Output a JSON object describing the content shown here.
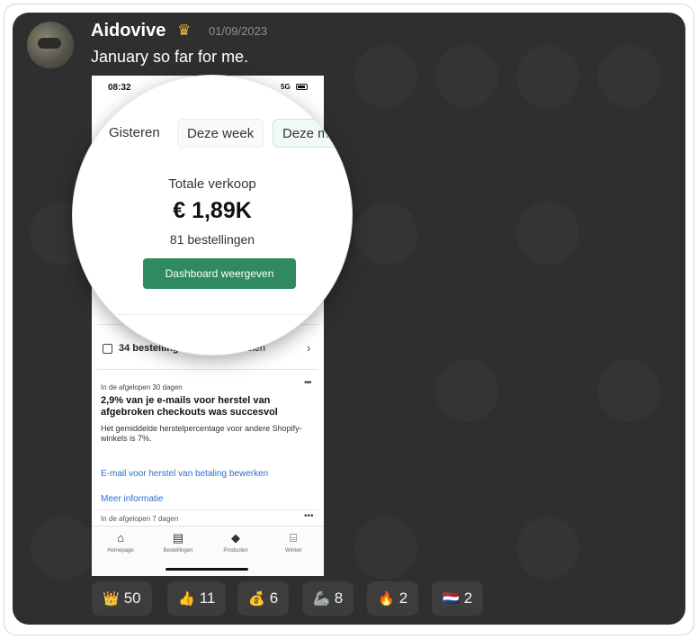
{
  "post": {
    "username": "Aidovive",
    "badge_icon": "crown-icon",
    "date": "01/09/2023",
    "message": "January so far for me."
  },
  "phone": {
    "status_time": "08:32",
    "network": "5G",
    "lens": {
      "tabs": [
        "Gisteren",
        "Deze week",
        "Deze m"
      ],
      "sales_label": "Totale verkoop",
      "sales_value": "€ 1,89K",
      "orders_count": "81 bestellingen",
      "dashboard_button": "Dashboard weergeven"
    },
    "orders_row": {
      "text": "34 bestelling",
      "tail": "ndelen"
    },
    "insight": {
      "kicker": "In de afgelopen 30 dagen",
      "title": "2,9% van je e-mails voor herstel van afgebroken checkouts was succesvol",
      "body": "Het gemiddelde herstelpercentage voor andere Shopify-winkels is 7%.",
      "link_primary": "E-mail voor herstel van betaling bewerken",
      "link_secondary": "Meer informatie"
    },
    "insight2_kicker": "In de afgelopen 7 dagen",
    "tabs": [
      {
        "label": "Homepage",
        "icon": "home-icon"
      },
      {
        "label": "Bestellingen",
        "icon": "orders-icon"
      },
      {
        "label": "Producten",
        "icon": "tag-icon"
      },
      {
        "label": "Winkel",
        "icon": "store-icon"
      }
    ]
  },
  "reactions": [
    {
      "emoji": "👑",
      "count": "50",
      "icon": "crown-icon"
    },
    {
      "emoji": "👍",
      "count": "11",
      "icon": "thumbs-up-icon"
    },
    {
      "emoji": "💰",
      "count": "6",
      "icon": "money-bag-icon"
    },
    {
      "emoji": "🦾",
      "count": "8",
      "icon": "mechanical-arm-icon"
    },
    {
      "emoji": "🔥",
      "count": "2",
      "icon": "fire-icon"
    },
    {
      "emoji": "🇳🇱",
      "count": "2",
      "icon": "netherlands-flag-icon"
    }
  ],
  "colors": {
    "card_bg": "#2f2f2f",
    "accent_green": "#2f8a5f",
    "link_blue": "#2c6ecb",
    "crown_gold": "#e7b83a"
  }
}
